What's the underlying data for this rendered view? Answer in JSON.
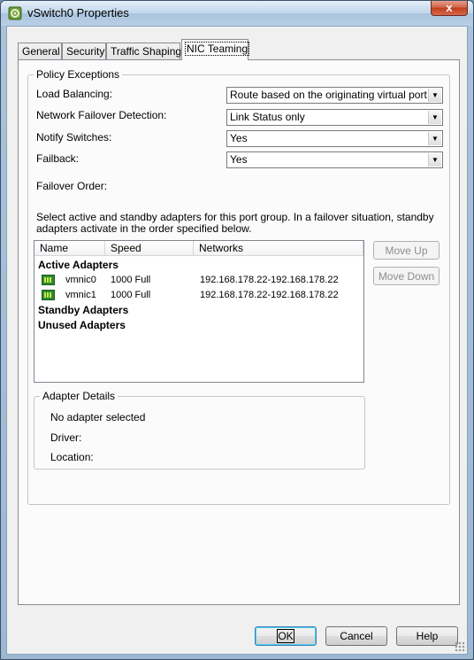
{
  "window": {
    "title": "vSwitch0 Properties",
    "close_glyph": "x",
    "app_icon": "vmware-properties-icon"
  },
  "tabs": [
    {
      "label": "General",
      "active": false
    },
    {
      "label": "Security",
      "active": false
    },
    {
      "label": "Traffic Shaping",
      "active": false
    },
    {
      "label": "NIC Teaming",
      "active": true
    }
  ],
  "policy": {
    "group_title": "Policy Exceptions",
    "load_balancing": {
      "label": "Load Balancing:",
      "value": "Route based on the originating virtual port ID"
    },
    "failover_detection": {
      "label": "Network Failover Detection:",
      "value": "Link Status only"
    },
    "notify_switches": {
      "label": "Notify Switches:",
      "value": "Yes"
    },
    "failback": {
      "label": "Failback:",
      "value": "Yes"
    },
    "failover_order_label": "Failover Order:",
    "description_line1": "Select active and standby adapters for this port group.  In a failover situation, standby",
    "description_line2": "adapters activate  in the order specified below."
  },
  "adapters_list": {
    "columns": [
      "Name",
      "Speed",
      "Networks"
    ],
    "groups": {
      "active": "Active Adapters",
      "standby": "Standby Adapters",
      "unused": "Unused Adapters"
    },
    "rows": [
      {
        "name": "vmnic0",
        "speed": "1000 Full",
        "networks": "192.168.178.22-192.168.178.22",
        "icon": "nic-icon"
      },
      {
        "name": "vmnic1",
        "speed": "1000 Full",
        "networks": "192.168.178.22-192.168.178.22",
        "icon": "nic-icon"
      }
    ]
  },
  "move_buttons": {
    "move_up": "Move Up",
    "move_down": "Move Down"
  },
  "adapter_details": {
    "group_title": "Adapter Details",
    "status": "No adapter selected",
    "driver_label": "Driver:",
    "location_label": "Location:"
  },
  "footer": {
    "ok": "OK",
    "cancel": "Cancel",
    "help": "Help"
  },
  "colors": {
    "titlebar": "#b8cfe6",
    "close_button": "#c2401f",
    "nic_icon": "#2f8a2f"
  }
}
